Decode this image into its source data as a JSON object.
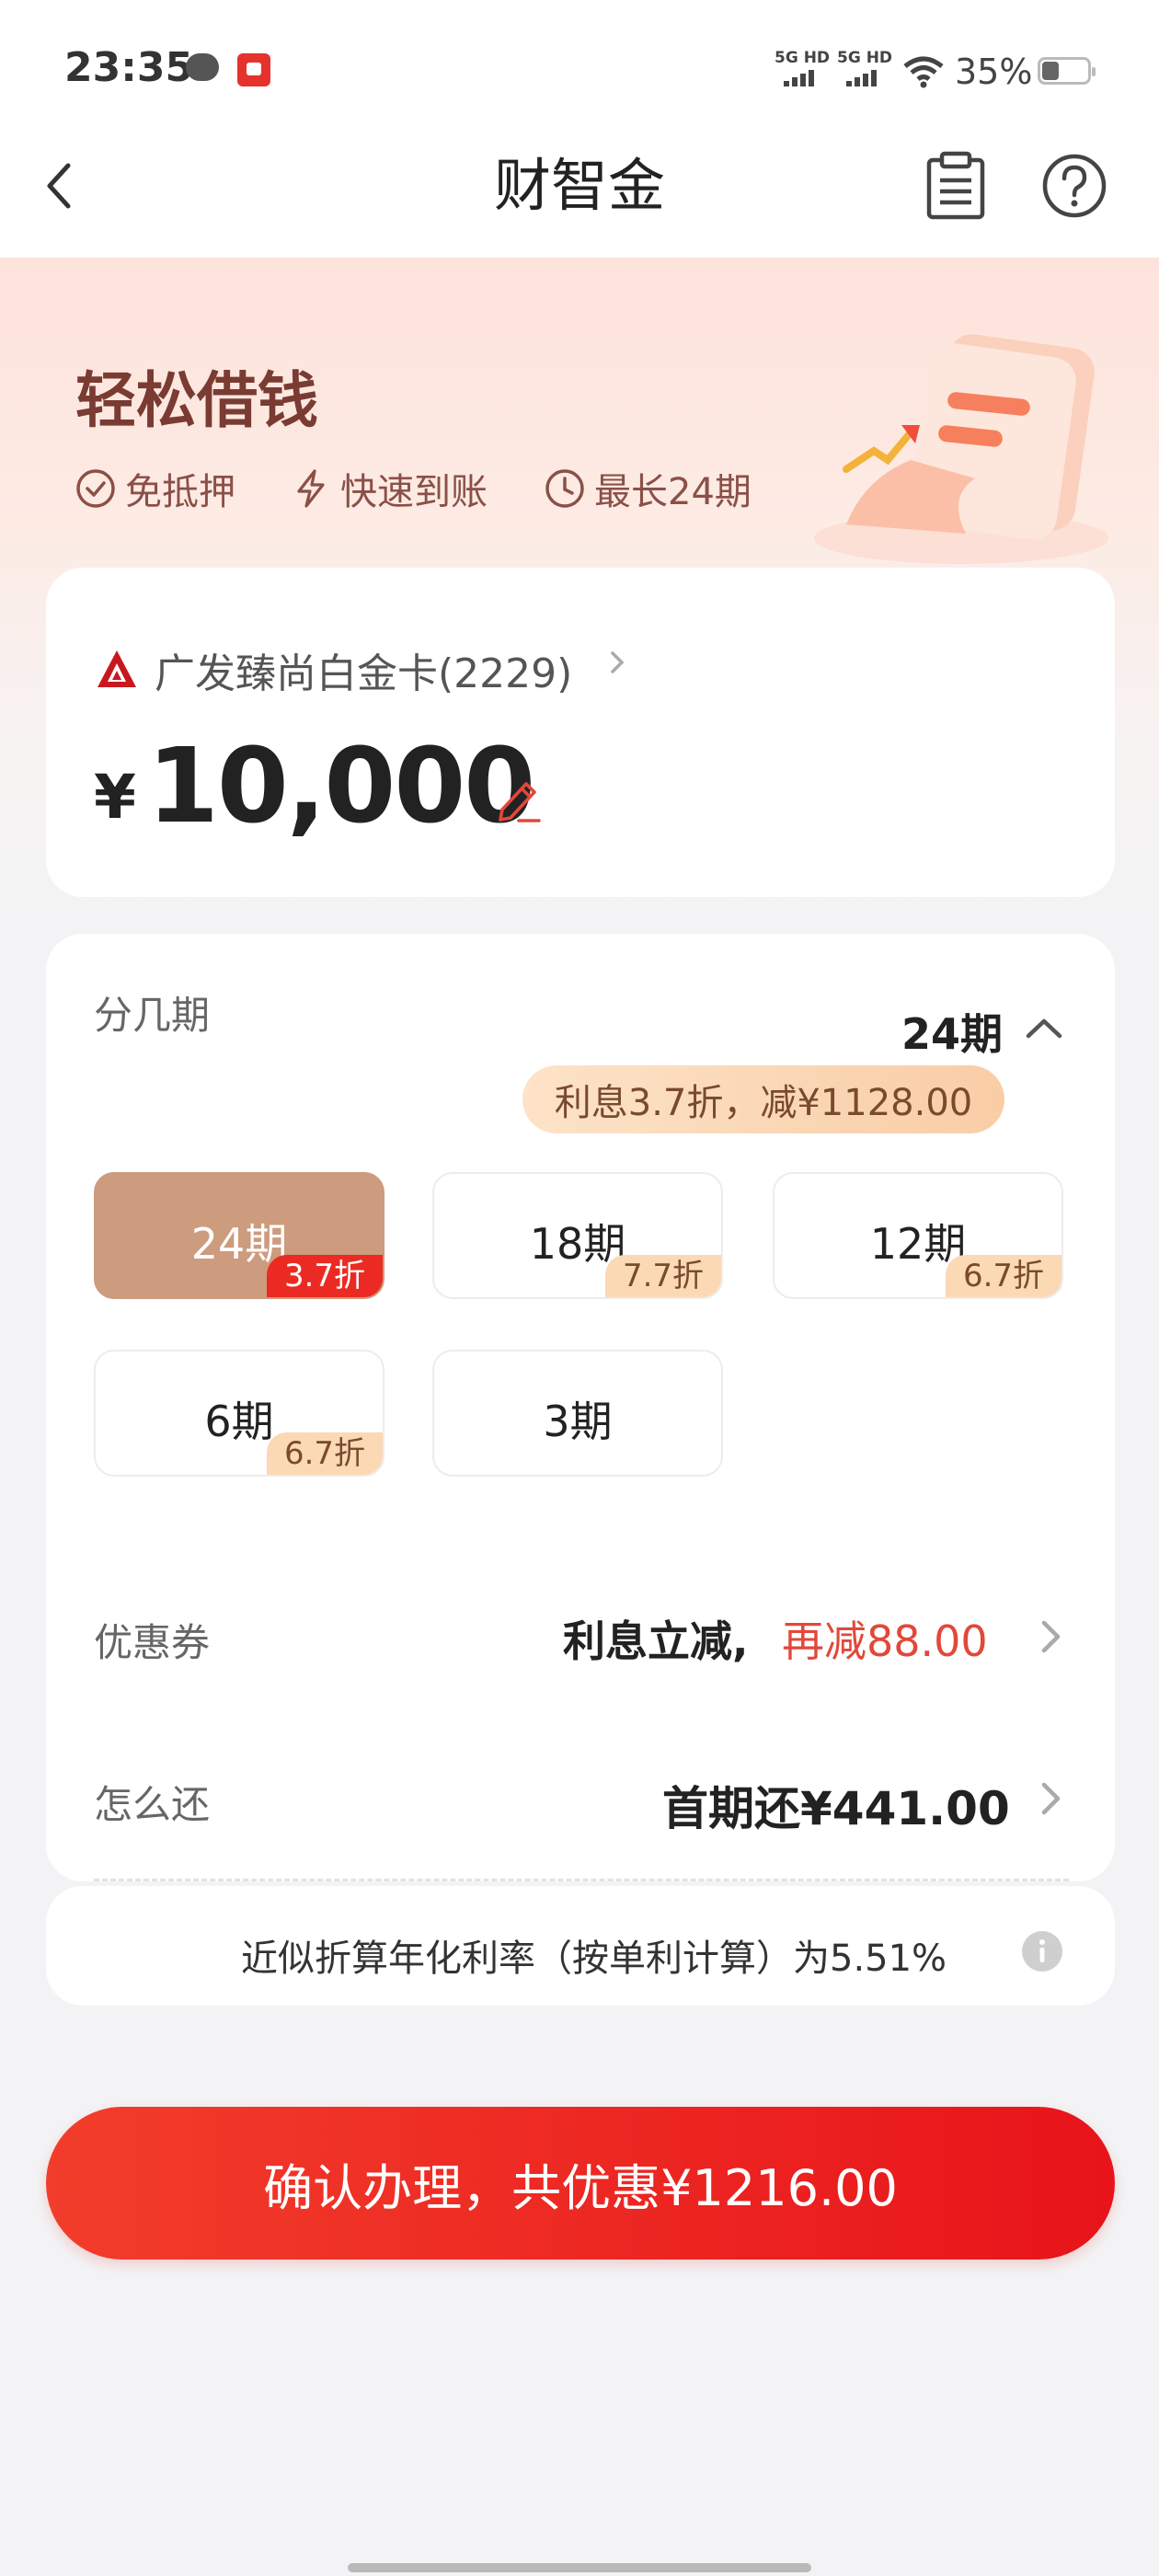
{
  "status_bar": {
    "time": "23:35",
    "sim1": "5G HD",
    "sim2": "5G HD",
    "battery": "35%"
  },
  "nav": {
    "title": "财智金",
    "back_icon": "chevron-left-icon",
    "doc_icon": "clipboard-icon",
    "help_icon": "question-circle-icon"
  },
  "hero": {
    "title": "轻松借钱",
    "features": [
      "免抵押",
      "快速到账",
      "最长24期"
    ]
  },
  "card": {
    "bank_name": "广发臻尚白金卡(2229)",
    "currency": "¥",
    "amount": "10,000"
  },
  "plan": {
    "label": "分几期",
    "selected": "24期",
    "promo": "利息3.7折，减¥1128.00",
    "options": [
      {
        "label": "24期",
        "tag": "3.7折",
        "selected": true
      },
      {
        "label": "18期",
        "tag": "7.7折",
        "selected": false
      },
      {
        "label": "12期",
        "tag": "6.7折",
        "selected": false
      },
      {
        "label": "6期",
        "tag": "6.7折",
        "selected": false
      },
      {
        "label": "3期",
        "tag": "",
        "selected": false
      }
    ]
  },
  "coupon": {
    "label": "优惠券",
    "value_main": "利息立减,",
    "value_highlight": "再减88.00"
  },
  "repay": {
    "label": "怎么还",
    "value": "首期还¥441.00"
  },
  "rate": {
    "text": "近似折算年化利率（按单利计算）为5.51%"
  },
  "confirm": {
    "label": "确认办理，共优惠¥1216.00"
  },
  "colors": {
    "accent": "#e8141a",
    "selected_option": "#cd9b7d",
    "highlight_text": "#e2483a"
  }
}
